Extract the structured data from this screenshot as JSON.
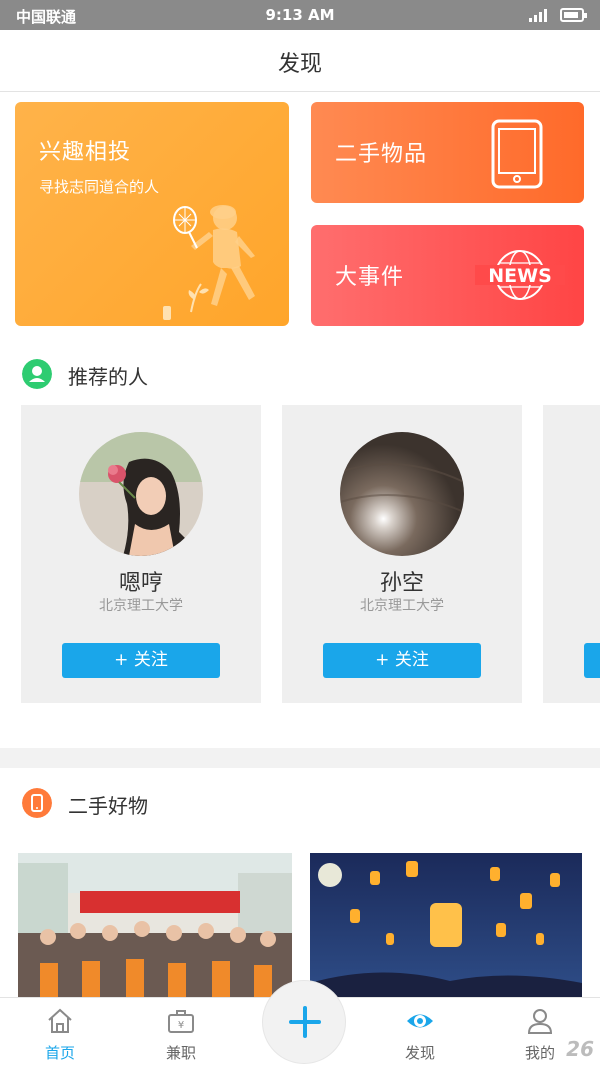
{
  "status_bar": {
    "carrier": "中国联通",
    "time": "9:13 AM"
  },
  "header": {
    "title": "发现"
  },
  "feature_cards": {
    "interest": {
      "title": "兴趣相投",
      "subtitle": "寻找志同道合的人"
    },
    "second_hand": {
      "title": "二手物品"
    },
    "events": {
      "title": "大事件",
      "badge": "NEWS"
    }
  },
  "recommended": {
    "section_title": "推荐的人",
    "people": [
      {
        "name": "嗯哼",
        "school": "北京理工大学",
        "follow_label": "+ 关注"
      },
      {
        "name": "孙空",
        "school": "北京理工大学",
        "follow_label": "+ 关注"
      }
    ]
  },
  "goods": {
    "section_title": "二手好物"
  },
  "tab_bar": {
    "tabs": [
      {
        "label": "首页",
        "icon": "home-icon",
        "active": true
      },
      {
        "label": "兼职",
        "icon": "briefcase-icon",
        "active": false
      },
      {
        "label": "发现",
        "icon": "eye-icon",
        "active": false
      },
      {
        "label": "我的",
        "icon": "user-icon",
        "active": false
      }
    ],
    "fab_icon": "plus-icon"
  },
  "colors": {
    "accent_blue": "#1aa6ea",
    "interest_orange": "#ffa52a",
    "second_hand_orange": "#ff6a2a",
    "events_red": "#ff4545",
    "recommend_green": "#2ecc71"
  },
  "watermark": "26"
}
